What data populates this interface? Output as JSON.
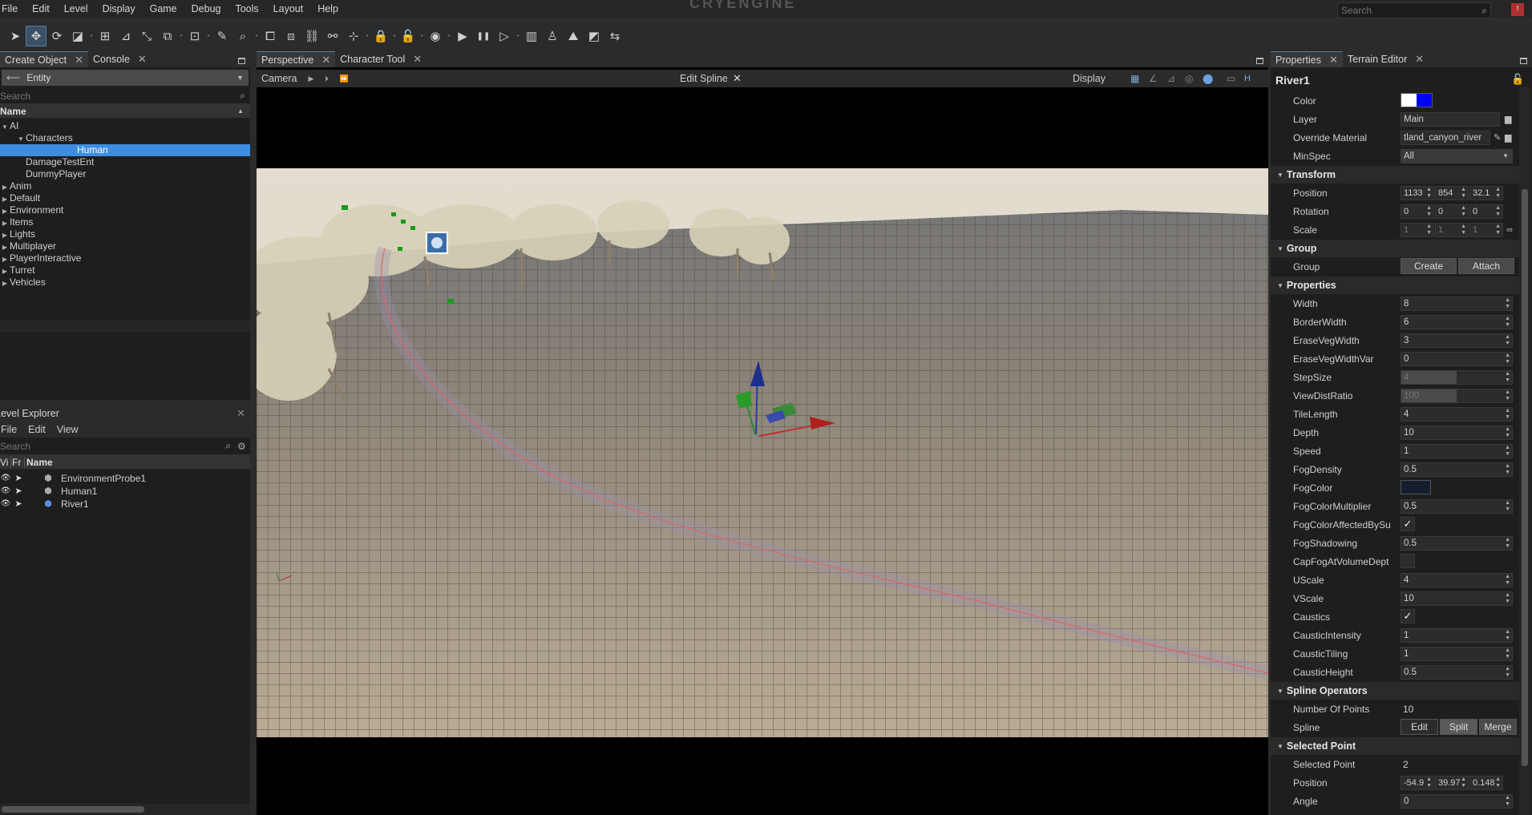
{
  "menu": [
    "File",
    "Edit",
    "Level",
    "Display",
    "Game",
    "Debug",
    "Tools",
    "Layout",
    "Help"
  ],
  "logo_text": "CRYENGINE",
  "top_search": {
    "placeholder": "Search"
  },
  "notify_badge": "!",
  "toolbar_icons": [
    "select-icon",
    "move-icon",
    "rotate-icon",
    "scale-icon",
    "snap-grid-icon",
    "snap-angle-icon",
    "snap-scale-icon",
    "snap-terrain-icon",
    "snap-object-icon",
    "paint-icon",
    "zoom-icon",
    "group-icon",
    "ungroup-icon",
    "link-icon",
    "unlink-icon",
    "align-icon",
    "lock-icon",
    "unlock-icon",
    "camera-icon",
    "play-icon",
    "pause-icon",
    "step-icon",
    "layout-icon",
    "character-icon",
    "terrain-icon",
    "landscape-icon",
    "export-icon"
  ],
  "create_panel": {
    "tabs": [
      {
        "label": "Create Object"
      },
      {
        "label": "Console"
      }
    ],
    "category": "Entity",
    "search_placeholder": "Search",
    "column": "Name",
    "tree": [
      {
        "label": "AI",
        "level": 0,
        "arrow": "down"
      },
      {
        "label": "Characters",
        "level": 1,
        "arrow": "down"
      },
      {
        "label": "Human",
        "level": 2,
        "arrow": "",
        "selected": true
      },
      {
        "label": "DamageTestEnt",
        "level": 1,
        "arrow": ""
      },
      {
        "label": "DummyPlayer",
        "level": 1,
        "arrow": ""
      },
      {
        "label": "Anim",
        "level": 0,
        "arrow": "right"
      },
      {
        "label": "Default",
        "level": 0,
        "arrow": "right"
      },
      {
        "label": "Environment",
        "level": 0,
        "arrow": "right"
      },
      {
        "label": "Items",
        "level": 0,
        "arrow": "right"
      },
      {
        "label": "Lights",
        "level": 0,
        "arrow": "right"
      },
      {
        "label": "Multiplayer",
        "level": 0,
        "arrow": "right"
      },
      {
        "label": "PlayerInteractive",
        "level": 0,
        "arrow": "right"
      },
      {
        "label": "Turret",
        "level": 0,
        "arrow": "right"
      },
      {
        "label": "Vehicles",
        "level": 0,
        "arrow": "right"
      }
    ]
  },
  "level_explorer": {
    "title": "Level Explorer",
    "menu": [
      "File",
      "Edit",
      "View"
    ],
    "search_placeholder": "Search",
    "columns": [
      "Vi",
      "Fr",
      "Name"
    ],
    "rows": [
      "EnvironmentProbe1",
      "Human1",
      "River1"
    ]
  },
  "viewport": {
    "tabs": [
      {
        "label": "Perspective"
      },
      {
        "label": "Character Tool"
      }
    ],
    "camera_label": "Camera",
    "mode_label": "Edit Spline",
    "display_label": "Display",
    "h_label": "H"
  },
  "properties": {
    "tabs": [
      {
        "label": "Properties"
      },
      {
        "label": "Terrain Editor"
      }
    ],
    "object_name": "River1",
    "colors": {
      "object_color": "#0000ff",
      "fog_color": "#141e2e",
      "accent": "#3d8ee0"
    },
    "general": {
      "color_label": "Color",
      "layer_label": "Layer",
      "layer_value": "Main",
      "material_label": "Override Material",
      "material_value": "tland_canyon_river",
      "minspec_label": "MinSpec",
      "minspec_value": "All"
    },
    "transform": {
      "title": "Transform",
      "position_label": "Position",
      "position": [
        "1133",
        "854",
        "32.1"
      ],
      "rotation_label": "Rotation",
      "rotation": [
        "0",
        "0",
        "0"
      ],
      "scale_label": "Scale",
      "scale": [
        "1",
        "1",
        "1"
      ]
    },
    "group": {
      "title": "Group",
      "label": "Group",
      "create": "Create",
      "attach": "Attach"
    },
    "props_title": "Properties",
    "props": [
      {
        "label": "Width",
        "value": "8"
      },
      {
        "label": "BorderWidth",
        "value": "6"
      },
      {
        "label": "EraseVegWidth",
        "value": "3"
      },
      {
        "label": "EraseVegWidthVar",
        "value": "0"
      },
      {
        "label": "StepSize",
        "value": "4"
      },
      {
        "label": "ViewDistRatio",
        "value": "100"
      },
      {
        "label": "TileLength",
        "value": "4"
      },
      {
        "label": "Depth",
        "value": "10"
      },
      {
        "label": "Speed",
        "value": "1"
      },
      {
        "label": "FogDensity",
        "value": "0.5"
      },
      {
        "label": "FogColor",
        "value": ""
      },
      {
        "label": "FogColorMultiplier",
        "value": "0.5"
      },
      {
        "label": "FogColorAffectedBySu",
        "value": "✓"
      },
      {
        "label": "FogShadowing",
        "value": "0.5"
      },
      {
        "label": "CapFogAtVolumeDept",
        "value": ""
      },
      {
        "label": "UScale",
        "value": "4"
      },
      {
        "label": "VScale",
        "value": "10"
      },
      {
        "label": "Caustics",
        "value": "✓"
      },
      {
        "label": "CausticIntensity",
        "value": "1"
      },
      {
        "label": "CausticTiling",
        "value": "1"
      },
      {
        "label": "CausticHeight",
        "value": "0.5"
      }
    ],
    "spline": {
      "title": "Spline Operators",
      "points_label": "Number Of Points",
      "points_value": "10",
      "spline_label": "Spline",
      "edit": "Edit",
      "split": "Split",
      "merge": "Merge"
    },
    "selected": {
      "title": "Selected Point",
      "point_label": "Selected Point",
      "point_value": "2",
      "position_label": "Position",
      "position": [
        "-54.9",
        "39.97",
        "0.148"
      ],
      "angle_label": "Angle",
      "angle_value": "0"
    }
  }
}
